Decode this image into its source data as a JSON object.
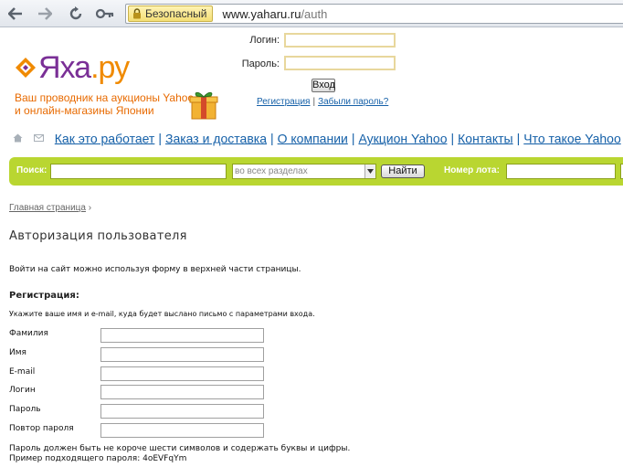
{
  "browser": {
    "security_label": "Безопасный",
    "url_host": "www.yaharu.ru",
    "url_path": "/auth"
  },
  "header": {
    "logo_part1": "Яха",
    "logo_part2": ".ру",
    "tagline_line1": "Ваш проводник на аукционы Yahoo",
    "tagline_line2": "и онлайн-магазины Японии",
    "login_label": "Логин:",
    "password_label": "Пароль:",
    "login_value": "",
    "password_value": "",
    "enter_button": "Вход",
    "register_link": "Регистрация",
    "links_separator": "|",
    "forgot_link": "Забыли пароль?"
  },
  "nav": {
    "separator": "|",
    "items": [
      "Как это работает",
      "Заказ и доставка",
      "О компании",
      "Аукцион Yahoo",
      "Контакты",
      "Что такое Yahoo"
    ]
  },
  "search": {
    "search_label": "Поиск:",
    "search_value": "",
    "section_selected": "во всех разделах",
    "find_button": "Найти",
    "lot_label": "Номер лота:",
    "lot_value": ""
  },
  "content": {
    "breadcrumb_home": "Главная страница",
    "breadcrumb_arrow": "›",
    "title": "Авторизация пользователя",
    "intro": "Войти на сайт можно используя форму в верхней части страницы.",
    "registration_heading": "Регистрация:",
    "registration_hint": "Укажите ваше имя и e-mail, куда будет выслано письмо с параметрами входа.",
    "fields": [
      {
        "label": "Фамилия",
        "value": ""
      },
      {
        "label": "Имя",
        "value": ""
      },
      {
        "label": "E-mail",
        "value": ""
      },
      {
        "label": "Логин",
        "value": ""
      },
      {
        "label": "Пароль",
        "value": ""
      },
      {
        "label": "Повтор пароля",
        "value": ""
      }
    ],
    "password_rule": "Пароль должен быть не короче шести символов и содержать буквы и цифры.",
    "password_example": "Пример подходящего пароля: 4oEVFqYm"
  },
  "colors": {
    "accent_green": "#b9d631",
    "link_blue": "#1560a8",
    "brand_orange": "#f08a00",
    "brand_purple": "#7a2f96"
  },
  "icons": {
    "back": "back-arrow-icon",
    "forward": "forward-arrow-icon",
    "reload": "reload-icon",
    "key": "key-icon",
    "lock": "lock-icon",
    "home": "home-icon",
    "mail": "mail-icon",
    "gift": "gift-icon"
  }
}
